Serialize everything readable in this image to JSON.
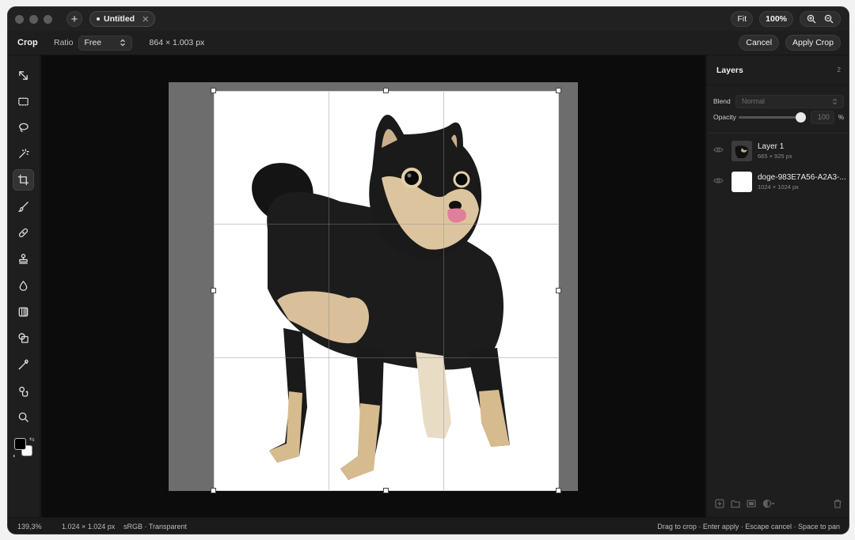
{
  "titlebar": {
    "document_tab": "Untitled",
    "new_tab_symbol": "+",
    "close_symbol": "✕",
    "fit_label": "Fit",
    "zoom_level": "100%"
  },
  "options": {
    "tool_name": "Crop",
    "ratio_label": "Ratio",
    "ratio_value": "Free",
    "crop_dimensions": "864 × 1.003 px",
    "cancel_label": "Cancel",
    "apply_label": "Apply Crop"
  },
  "toolbar": {
    "tools": [
      "move-icon",
      "rect-select-icon",
      "lasso-icon",
      "magic-wand-icon",
      "crop-icon",
      "brush-icon",
      "healing-icon",
      "stamp-icon",
      "blur-drop-icon",
      "gradient-icon",
      "shape-icon",
      "eyedropper-icon",
      "hand-icon",
      "zoom-icon"
    ],
    "active_tool": "crop-icon",
    "colors": {
      "foreground": "#000000",
      "background": "#ffffff"
    }
  },
  "layers_panel": {
    "title": "Layers",
    "count": "2",
    "blend_label": "Blend",
    "blend_value": "Normal",
    "opacity_label": "Opacity",
    "opacity_value": "100",
    "opacity_unit": "%",
    "opacity_fraction": 1.0,
    "layers": [
      {
        "name": "Layer 1",
        "size": "665 × 925 px"
      },
      {
        "name": "doge-983E7A56-A2A3-...",
        "size": "1024 × 1024 px"
      }
    ]
  },
  "status": {
    "zoom": "139,3%",
    "image_size": "1.024 × 1.024 px",
    "color_profile": "sRGB · Transparent",
    "hint": "Drag to crop · Enter apply · Escape cancel · Space to pan"
  },
  "colors": {
    "window_bg": "#1b1b1b",
    "canvas_bg": "#0c0c0c",
    "image_gray": "#6d6d6d",
    "accent": "#e6e6e6"
  }
}
